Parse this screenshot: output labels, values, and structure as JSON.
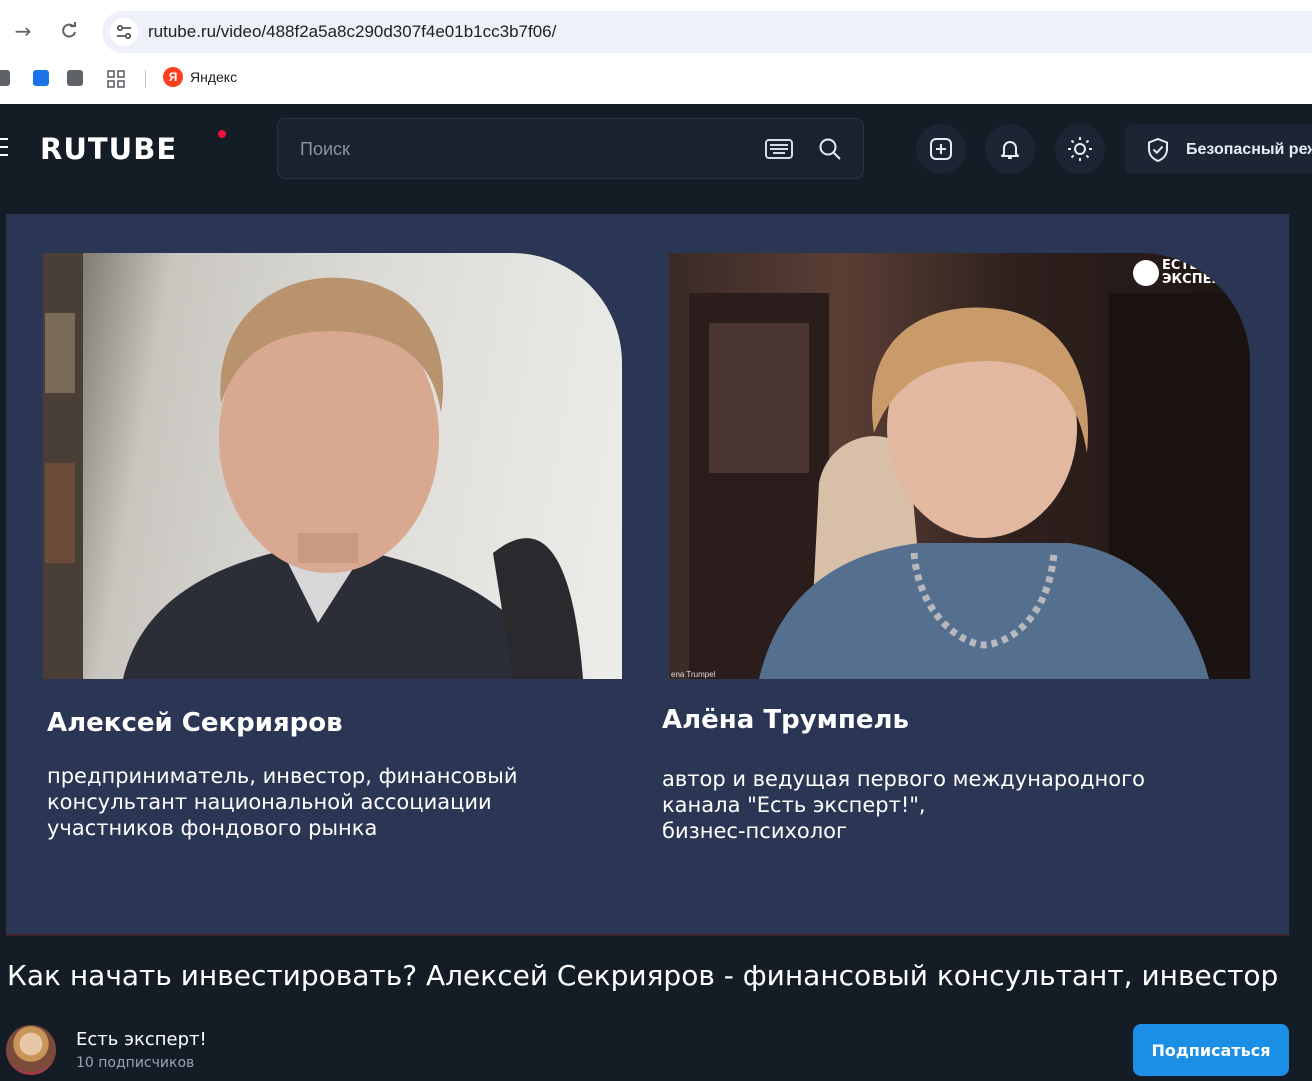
{
  "browser": {
    "url": "rutube.ru/video/488f2a5a8c290d307f4e01b1cc3b7f06/",
    "bookmarks": [
      {
        "label": "Яндекс",
        "icon": "yandex-icon"
      }
    ]
  },
  "header": {
    "logo": "RUTUBE",
    "search_placeholder": "Поиск",
    "safe_mode_label": "Безопасный реж"
  },
  "video": {
    "left_person": {
      "name": "Алексей Секрияров",
      "description": [
        "предприниматель, инвестор, финансовый",
        "консультант национальной ассоциации",
        "участников фондового рынка"
      ]
    },
    "right_person": {
      "name": "Алёна Трумпель",
      "description": [
        "автор и ведущая первого международного",
        "канала \"Есть эксперт!\",",
        "бизнес-психолог"
      ],
      "cam_label": "ena Trumpel"
    },
    "brand_mark": [
      "ЕСТЬ",
      "ЭКСПЕРТ!"
    ]
  },
  "title": "Как начать инвестировать? Алексей Секрияров - финансовый консультант, инвестор",
  "channel": {
    "name": "Есть эксперт!",
    "subscribers": "10 подписчиков",
    "subscribe_label": "Подписаться"
  },
  "colors": {
    "accent": "#1b8fe5",
    "logo_dot": "#ed143b",
    "video_bg": "#2a3654",
    "page_bg": "#141c26"
  }
}
